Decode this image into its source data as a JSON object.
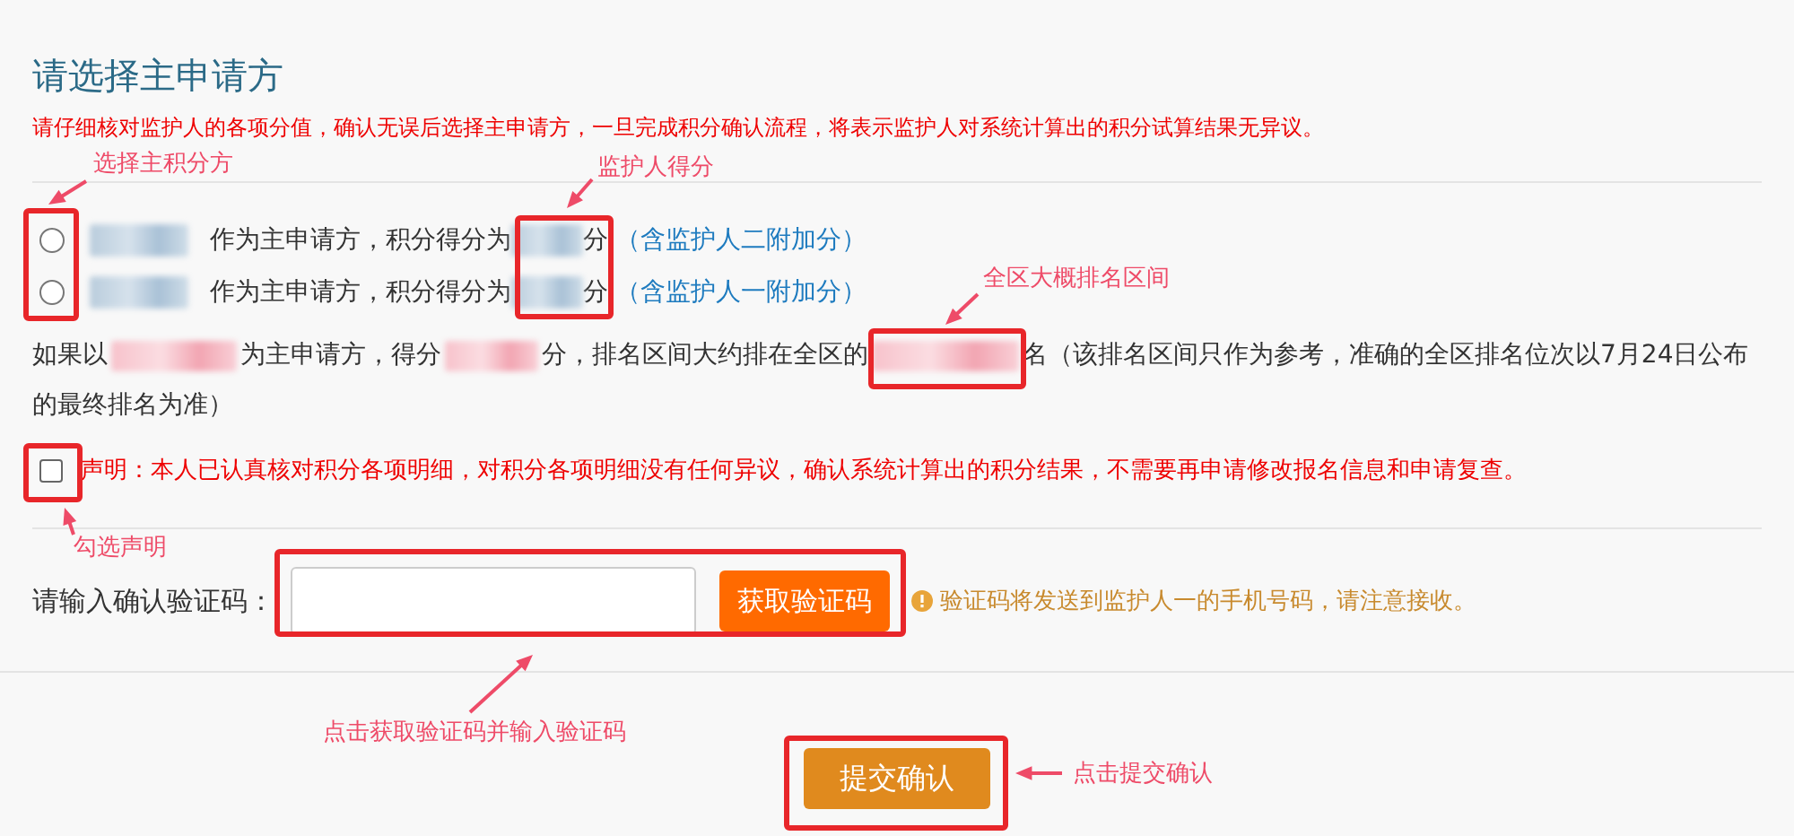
{
  "title": "请选择主申请方",
  "notice": "请仔细核对监护人的各项分值，确认无误后选择主申请方，一旦完成积分确认流程，将表示监护人对系统计算出的积分试算结果无异议。",
  "options": [
    {
      "selected": false,
      "text": "作为主申请方，积分得分为",
      "unit": "分",
      "note": "（含监护人二附加分）"
    },
    {
      "selected": false,
      "text": "作为主申请方，积分得分为",
      "unit": "分",
      "note": "（含监护人一附加分）"
    }
  ],
  "ranking_note": [
    {
      "kind": "text",
      "text": "如果以"
    },
    {
      "kind": "redacted"
    },
    {
      "kind": "text",
      "text": "为主申请方，得分"
    },
    {
      "kind": "redacted"
    },
    {
      "kind": "text",
      "text": "分，排名区间大约排在全区的"
    },
    {
      "kind": "redacted"
    },
    {
      "kind": "text",
      "text": "名（该排名区间只作为参考，准确的全区排名位次以7月24日公布的最终排名为准）"
    }
  ],
  "declaration": {
    "checked": false,
    "text": "声明：本人已认真核对积分各项明细，对积分各项明细没有任何异议，确认系统计算出的积分结果，不需要再申请修改报名信息和申请复查。"
  },
  "verification": {
    "label": "请输入确认验证码：",
    "button": "获取验证码",
    "hint": "验证码将发送到监护人一的手机号码，请注意接收。"
  },
  "submit": "提交确认",
  "annotations": [
    {
      "text": "选择主积分方"
    },
    {
      "text": "监护人得分"
    },
    {
      "text": "全区大概排名区间"
    },
    {
      "text": "勾选声明"
    },
    {
      "text": "点击获取验证码并输入验证码"
    },
    {
      "text": "点击提交确认"
    }
  ]
}
